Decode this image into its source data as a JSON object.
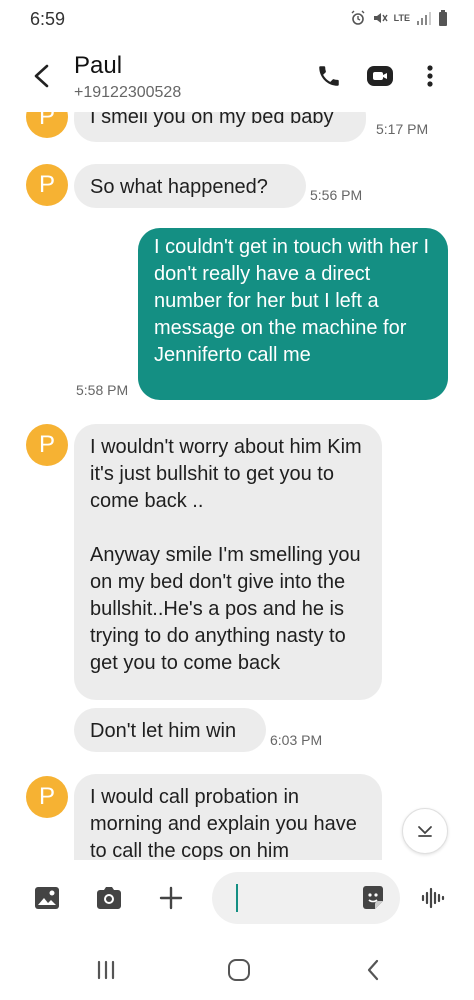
{
  "status_bar": {
    "time": "6:59",
    "network": "LTE"
  },
  "header": {
    "contact_name": "Paul",
    "contact_number": "+19122300528"
  },
  "avatar_letter": "P",
  "messages": [
    {
      "text": "I smell you on my bed baby",
      "time": "5:17 PM",
      "direction": "incoming"
    },
    {
      "text": "So what happened?",
      "time": "5:56 PM",
      "direction": "incoming"
    },
    {
      "text": "I couldn't get in touch with her I don't really have a direct number for her but I left a message on the machine for Jenniferto call me",
      "time": "5:58 PM",
      "direction": "outgoing"
    },
    {
      "text": "I wouldn't worry about him Kim it's just bullshit to get you to come back ..\n\nAnyway smile I'm smelling you on my bed don't give into the bullshit..He's a pos and he is trying to do anything nasty to get you to come back",
      "time": "",
      "direction": "incoming"
    },
    {
      "text": "Don't let him win",
      "time": "6:03 PM",
      "direction": "incoming"
    },
    {
      "text": "I would call probation in morning and explain you have to call the cops on him",
      "time": "",
      "direction": "incoming"
    }
  ],
  "composer": {
    "placeholder": ""
  },
  "colors": {
    "outgoing_bubble": "#148f83",
    "incoming_bubble": "#ececec",
    "avatar": "#f6b233"
  },
  "icons": [
    "back-arrow-icon",
    "phone-icon",
    "video-call-icon",
    "more-options-icon",
    "gallery-icon",
    "camera-icon",
    "add-icon",
    "sticker-icon",
    "voice-input-icon",
    "scroll-down-icon",
    "recent-apps-icon",
    "home-icon",
    "nav-back-icon"
  ]
}
